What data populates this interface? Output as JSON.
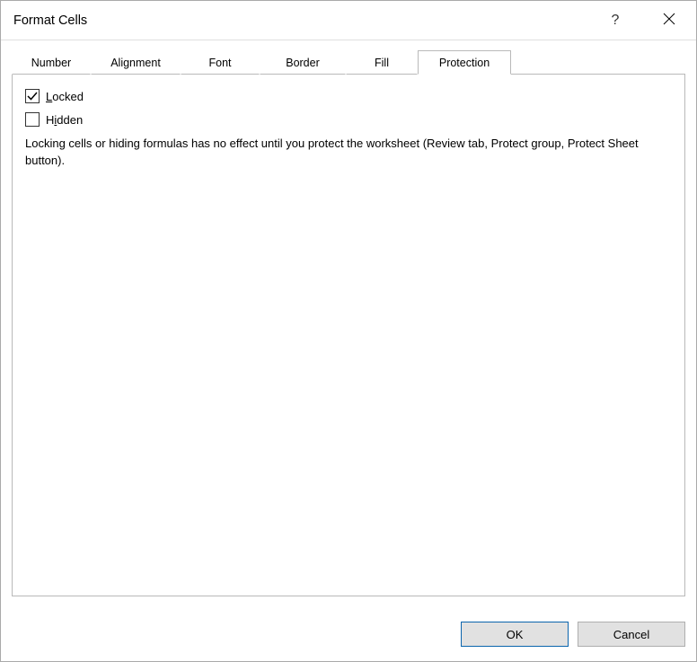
{
  "titlebar": {
    "title": "Format Cells"
  },
  "tabs": {
    "number": {
      "label": "Number"
    },
    "alignment": {
      "label": "Alignment"
    },
    "font": {
      "label": "Font"
    },
    "border": {
      "label": "Border"
    },
    "fill": {
      "label": "Fill"
    },
    "protection": {
      "label": "Protection"
    }
  },
  "protection_pane": {
    "locked": {
      "accesskey": "L",
      "rest": "ocked",
      "checked": true
    },
    "hidden": {
      "pre": "H",
      "accesskey": "i",
      "rest": "dden",
      "checked": false
    },
    "info": "Locking cells or hiding formulas has no effect until you protect the worksheet (Review tab, Protect group, Protect Sheet button)."
  },
  "buttons": {
    "ok": "OK",
    "cancel": "Cancel"
  }
}
